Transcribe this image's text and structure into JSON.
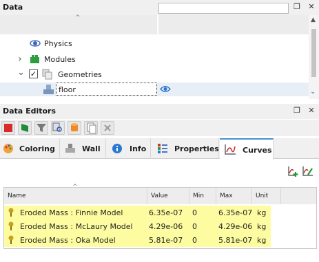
{
  "data_panel": {
    "title": "Data",
    "search_value": "",
    "tree": [
      {
        "label": "Physics",
        "icon": "physics-icon",
        "expand": ""
      },
      {
        "label": "Modules",
        "icon": "modules-icon",
        "expand": "›"
      },
      {
        "label": "Geometries",
        "icon": "geometries-icon",
        "expand": "⌄",
        "checked": true
      },
      {
        "label": "floor",
        "icon": "floor-icon",
        "selected": true,
        "visible": true
      }
    ]
  },
  "editors_panel": {
    "title": "Data Editors",
    "tabs": [
      {
        "label": "Coloring",
        "icon": "palette-icon"
      },
      {
        "label": "Wall",
        "icon": "wall-icon"
      },
      {
        "label": "Info",
        "icon": "info-icon"
      },
      {
        "label": "Properties",
        "icon": "properties-icon"
      },
      {
        "label": "Curves",
        "icon": "curves-icon",
        "active": true
      }
    ],
    "table": {
      "headers": [
        "Name",
        "Value",
        "Min",
        "Max",
        "Unit"
      ],
      "rows": [
        {
          "name": "Eroded Mass : Finnie Model",
          "value": "6.35e-07",
          "min": "0",
          "max": "6.35e-07",
          "unit": "kg"
        },
        {
          "name": "Eroded Mass : McLaury Model",
          "value": "4.29e-06",
          "min": "0",
          "max": "4.29e-06",
          "unit": "kg"
        },
        {
          "name": "Eroded Mass : Oka Model",
          "value": "5.81e-07",
          "min": "0",
          "max": "5.81e-07",
          "unit": "kg"
        }
      ]
    }
  },
  "colors": {
    "row_highlight": "#fdfca0",
    "active_tab_accent": "#4a8fd8",
    "selection": "#e8eef6"
  }
}
